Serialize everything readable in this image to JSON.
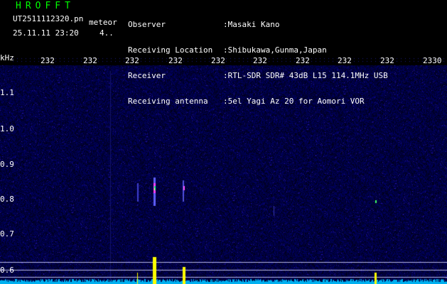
{
  "header": {
    "logo": "HROFFT",
    "filename": "UT2511112320.pn",
    "meteor_label": "meteor",
    "datetime": "25.11.11 23:20",
    "count": "4..",
    "info": [
      {
        "label": "Observer",
        "value": ":Masaki Kano"
      },
      {
        "label": "Receiving Location",
        "value": ":Shibukawa,Gunma,Japan"
      },
      {
        "label": "Receiver",
        "value": ":RTL-SDR SDR# 43dB L15 114.1MHz USB"
      },
      {
        "label": "Receiving antenna",
        "value": ":5el Yagi Az 20 for Aomori VOR"
      }
    ]
  },
  "axis": {
    "unit": "kHz",
    "time_ticks": [
      "232",
      "232",
      "232",
      "232",
      "232",
      "232",
      "232",
      "232",
      "232",
      "2330"
    ],
    "freq_labels": [
      "1.1",
      "1.0",
      "0.9",
      "0.8",
      "0.7",
      "0.6"
    ]
  },
  "colors": {
    "background": "#000000",
    "noise": "#00008b",
    "text_green": "#00ff00",
    "text_white": "#ffffff",
    "signal_yellow": "#ffff00",
    "baseline_cyan": "#00c8ff",
    "guide_lines": "#c8c8ff"
  }
}
